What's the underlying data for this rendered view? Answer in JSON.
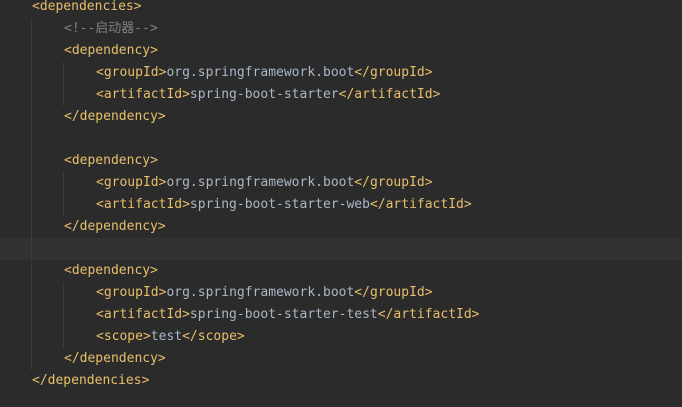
{
  "editor": {
    "lines": [
      {
        "indent": 0,
        "parts": [
          {
            "type": "tag",
            "text": "<dependencies>"
          }
        ]
      },
      {
        "indent": 1,
        "parts": [
          {
            "type": "comment",
            "text": "<!--启动器-->"
          }
        ]
      },
      {
        "indent": 1,
        "parts": [
          {
            "type": "tag",
            "text": "<dependency>"
          }
        ]
      },
      {
        "indent": 2,
        "parts": [
          {
            "type": "tag",
            "text": "<groupId>"
          },
          {
            "type": "text",
            "text": "org.springframework.boot"
          },
          {
            "type": "tag",
            "text": "</groupId>"
          }
        ]
      },
      {
        "indent": 2,
        "parts": [
          {
            "type": "tag",
            "text": "<artifactId>"
          },
          {
            "type": "text",
            "text": "spring-boot-starter"
          },
          {
            "type": "tag",
            "text": "</artifactId>"
          }
        ]
      },
      {
        "indent": 1,
        "parts": [
          {
            "type": "tag",
            "text": "</dependency>"
          }
        ]
      },
      {
        "indent": 1,
        "parts": []
      },
      {
        "indent": 1,
        "parts": [
          {
            "type": "tag",
            "text": "<dependency>"
          }
        ]
      },
      {
        "indent": 2,
        "parts": [
          {
            "type": "tag",
            "text": "<groupId>"
          },
          {
            "type": "text",
            "text": "org.springframework.boot"
          },
          {
            "type": "tag",
            "text": "</groupId>"
          }
        ]
      },
      {
        "indent": 2,
        "parts": [
          {
            "type": "tag",
            "text": "<artifactId>"
          },
          {
            "type": "text",
            "text": "spring-boot-starter-web"
          },
          {
            "type": "tag",
            "text": "</artifactId>"
          }
        ]
      },
      {
        "indent": 1,
        "parts": [
          {
            "type": "tag",
            "text": "</dependency>"
          }
        ]
      },
      {
        "indent": 1,
        "parts": [],
        "current": true
      },
      {
        "indent": 1,
        "parts": [
          {
            "type": "tag",
            "text": "<dependency>"
          }
        ]
      },
      {
        "indent": 2,
        "parts": [
          {
            "type": "tag",
            "text": "<groupId>"
          },
          {
            "type": "text",
            "text": "org.springframework.boot"
          },
          {
            "type": "tag",
            "text": "</groupId>"
          }
        ]
      },
      {
        "indent": 2,
        "parts": [
          {
            "type": "tag",
            "text": "<artifactId>"
          },
          {
            "type": "text",
            "text": "spring-boot-starter-test"
          },
          {
            "type": "tag",
            "text": "</artifactId>"
          }
        ]
      },
      {
        "indent": 2,
        "parts": [
          {
            "type": "tag",
            "text": "<scope>"
          },
          {
            "type": "text",
            "text": "test"
          },
          {
            "type": "tag",
            "text": "</scope>"
          }
        ]
      },
      {
        "indent": 1,
        "parts": [
          {
            "type": "tag",
            "text": "</dependency>"
          }
        ]
      },
      {
        "indent": 0,
        "parts": [
          {
            "type": "tag",
            "text": "</dependencies>"
          }
        ]
      }
    ]
  },
  "colors": {
    "background": "#2b2b2b",
    "current_line": "#323232",
    "tag": "#e8bf6a",
    "text": "#a9b7c6",
    "comment": "#808080"
  }
}
